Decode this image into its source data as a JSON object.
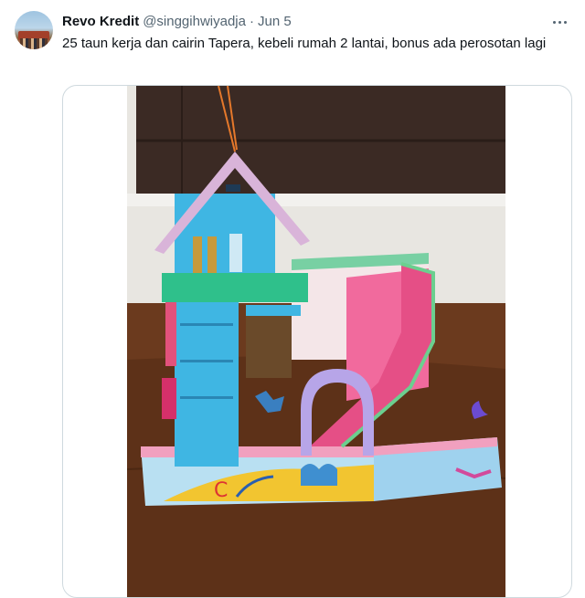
{
  "tweet": {
    "author_name": "Revo Kredit",
    "author_handle": "@singgihwiyadja",
    "separator": "·",
    "date": "Jun 5",
    "text": "25 taun kerja dan cairin Tapera, kebeli rumah 2 lantai, bonus ada perosotan lagi"
  },
  "icons": {
    "more": "more-horizontal-icon"
  },
  "colors": {
    "primary_text": "#0f1419",
    "secondary_text": "#536471",
    "border": "#cfd9de"
  }
}
